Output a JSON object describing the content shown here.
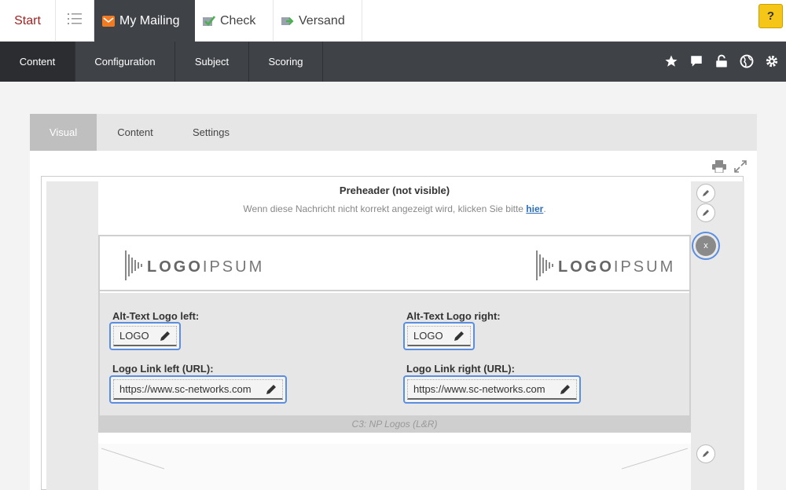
{
  "topnav": {
    "start": "Start",
    "mailing": "My Mailing",
    "check": "Check",
    "versand": "Versand",
    "help": "?"
  },
  "subnav": {
    "content": "Content",
    "configuration": "Configuration",
    "subject": "Subject",
    "scoring": "Scoring",
    "icons": [
      "star-icon",
      "comment-icon",
      "unlock-icon",
      "globe-icon",
      "gear-icon"
    ]
  },
  "tabs": {
    "visual": "Visual",
    "content": "Content",
    "settings": "Settings"
  },
  "preheader": {
    "title": "Preheader (not visible)",
    "text": "Wenn diese Nachricht nicht korrekt angezeigt wird, klicken Sie bitte ",
    "link": "hier",
    "suffix": "."
  },
  "logo_block": {
    "logo_left": {
      "part1": "LOGO",
      "part2": "IPSUM"
    },
    "logo_right": {
      "part1": "LOGO",
      "part2": "IPSUM"
    },
    "alt_left_label": "Alt-Text Logo left:",
    "alt_left_value": "LOGO",
    "alt_right_label": "Alt-Text Logo right:",
    "alt_right_value": "LOGO",
    "link_left_label": "Logo Link left (URL):",
    "link_left_value": "https://www.sc-networks.com",
    "link_right_label": "Logo Link right (URL):",
    "link_right_value": "https://www.sc-networks.com",
    "footer": "C3: NP Logos (L&R)"
  },
  "remove_button": "x",
  "colors": {
    "accent": "#5b8ee0",
    "nav_dark": "#3f4247",
    "start_red": "#a02323",
    "help_yellow": "#f5c518",
    "link_blue": "#2a6ebb"
  }
}
